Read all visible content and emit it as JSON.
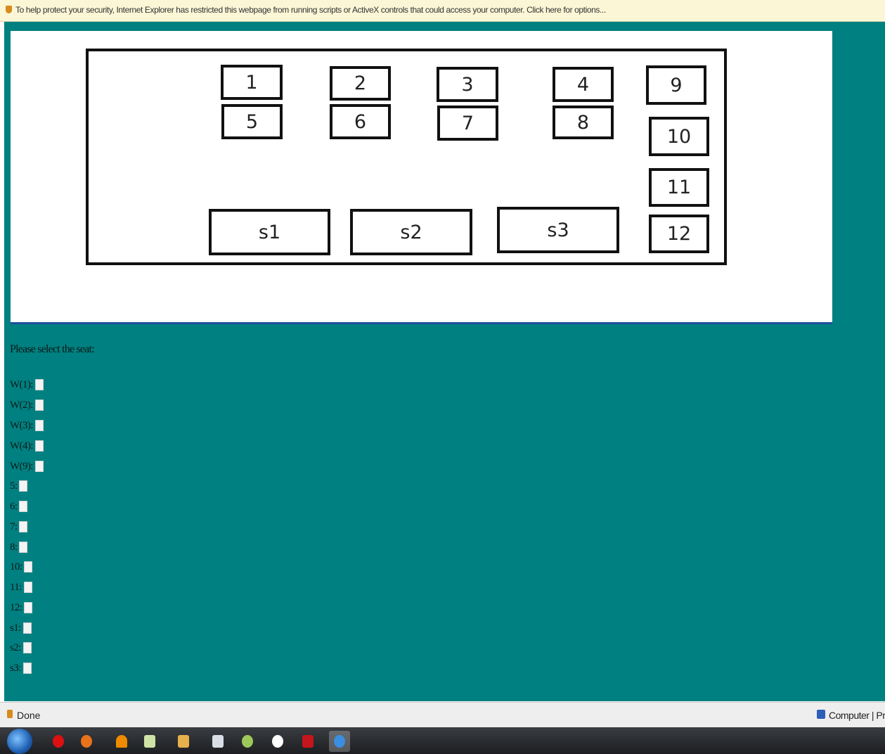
{
  "infobar": {
    "message": "To help protect your security, Internet Explorer has restricted this webpage from running scripts or ActiveX controls that could access your computer. Click here for options..."
  },
  "seat_map": {
    "seats": [
      "1",
      "2",
      "3",
      "4",
      "5",
      "6",
      "7",
      "8",
      "9",
      "10",
      "11",
      "12",
      "s1",
      "s2",
      "s3"
    ]
  },
  "form": {
    "prompt": "Please select the seat:",
    "options": [
      "W(1):",
      "W(2):",
      "W(3):",
      "W(4):",
      "W(9):",
      "5:",
      "6:",
      "7:",
      "8:",
      "10:",
      "11:",
      "12:",
      "s1:",
      "s2:",
      "s3:"
    ]
  },
  "statusbar": {
    "status": "Done",
    "zone": "Computer | Pr"
  },
  "taskbar": {
    "icons": [
      "windows-start-icon",
      "opera-icon",
      "firefox-icon",
      "vlc-icon",
      "notepad-icon",
      "archive-icon",
      "document-icon",
      "paint-icon",
      "media-icon",
      "pdf-icon",
      "internet-explorer-icon"
    ]
  }
}
